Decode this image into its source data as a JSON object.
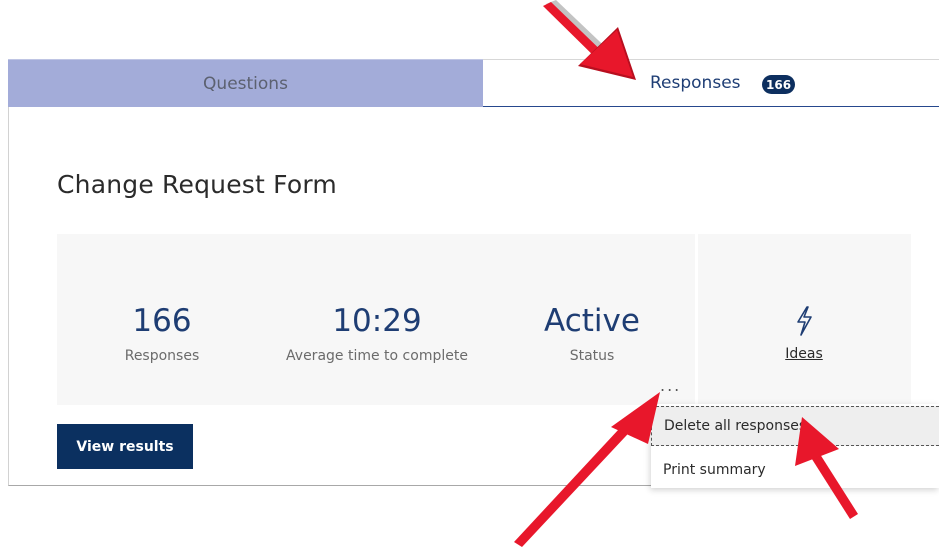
{
  "tabs": [
    {
      "label": "Questions",
      "selected": false
    },
    {
      "label": "Responses",
      "selected": true,
      "badge": "166"
    }
  ],
  "form": {
    "title": "Change Request Form"
  },
  "stats": [
    {
      "value": "166",
      "caption": "Responses"
    },
    {
      "value": "10:29",
      "caption": "Average time to complete"
    },
    {
      "value": "Active",
      "caption": "Status"
    }
  ],
  "ideas": {
    "label": "Ideas",
    "icon": "lightning-icon"
  },
  "more": {
    "label": "...",
    "icon": "more-horizontal-icon"
  },
  "actions": {
    "view_results": "View results"
  },
  "menu": {
    "items": [
      {
        "label": "Delete all responses",
        "highlighted": true
      },
      {
        "label": "Print summary",
        "highlighted": false
      }
    ]
  },
  "colors": {
    "accent": "#0b3060",
    "tab_inactive_bg": "#a3acd9",
    "stat_value": "#1e3d73",
    "annotation_arrow": "#e8172b"
  }
}
